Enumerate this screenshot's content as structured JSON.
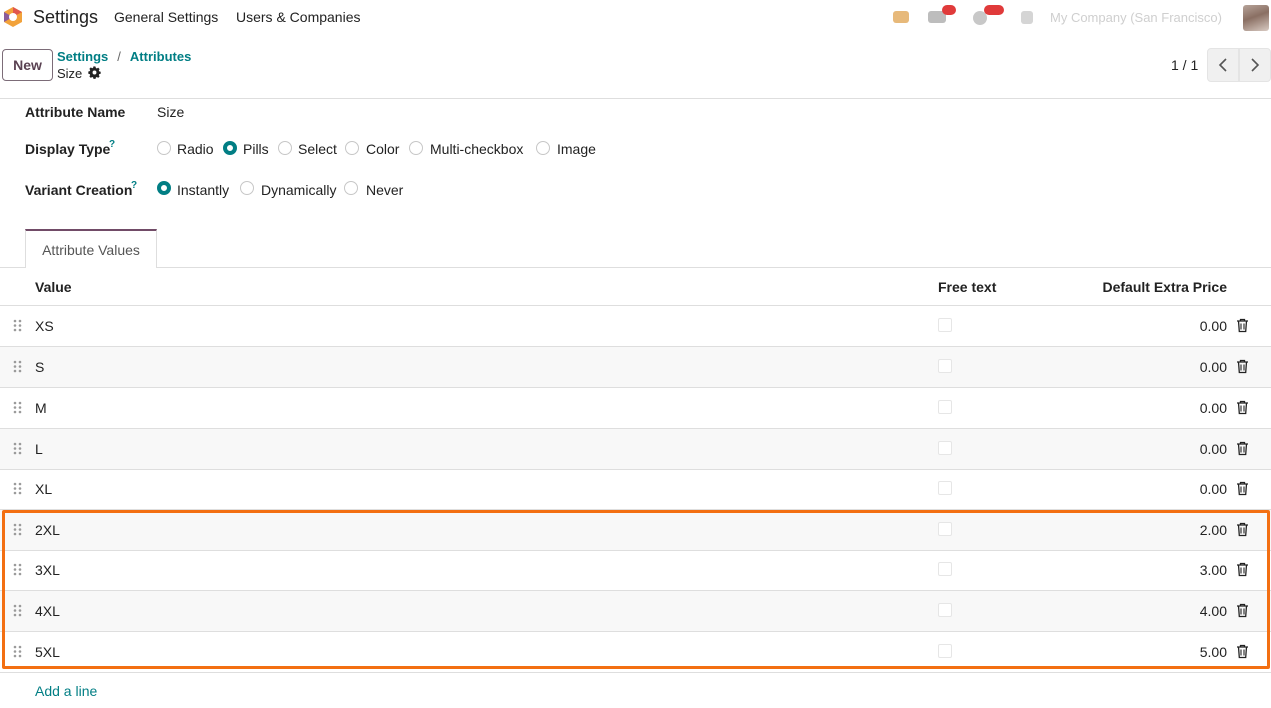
{
  "navbar": {
    "app_title": "Settings",
    "menu": [
      "General Settings",
      "Users & Companies"
    ],
    "company": "My Company (San Francisco)"
  },
  "control_panel": {
    "new_label": "New",
    "breadcrumb": [
      "Settings",
      "Attributes"
    ],
    "record_name": "Size",
    "pager": "1 / 1"
  },
  "form": {
    "attribute_name_label": "Attribute Name",
    "attribute_name_value": "Size",
    "display_type_label": "Display Type",
    "display_type_options": [
      "Radio",
      "Pills",
      "Select",
      "Color",
      "Multi-checkbox",
      "Image"
    ],
    "display_type_selected": "Pills",
    "variant_creation_label": "Variant Creation",
    "variant_creation_options": [
      "Instantly",
      "Dynamically",
      "Never"
    ],
    "variant_creation_selected": "Instantly",
    "help_mark": "?"
  },
  "tabs": [
    "Attribute Values"
  ],
  "table": {
    "columns": [
      "Value",
      "Free text",
      "Default Extra Price"
    ],
    "rows": [
      {
        "value": "XS",
        "free_text": false,
        "price": "0.00"
      },
      {
        "value": "S",
        "free_text": false,
        "price": "0.00"
      },
      {
        "value": "M",
        "free_text": false,
        "price": "0.00"
      },
      {
        "value": "L",
        "free_text": false,
        "price": "0.00"
      },
      {
        "value": "XL",
        "free_text": false,
        "price": "0.00"
      },
      {
        "value": "2XL",
        "free_text": false,
        "price": "2.00"
      },
      {
        "value": "3XL",
        "free_text": false,
        "price": "3.00"
      },
      {
        "value": "4XL",
        "free_text": false,
        "price": "4.00"
      },
      {
        "value": "5XL",
        "free_text": false,
        "price": "5.00"
      }
    ],
    "add_line": "Add a line"
  },
  "colors": {
    "primary": "#714b67",
    "accent": "#017e84",
    "highlight": "#f36f12"
  }
}
